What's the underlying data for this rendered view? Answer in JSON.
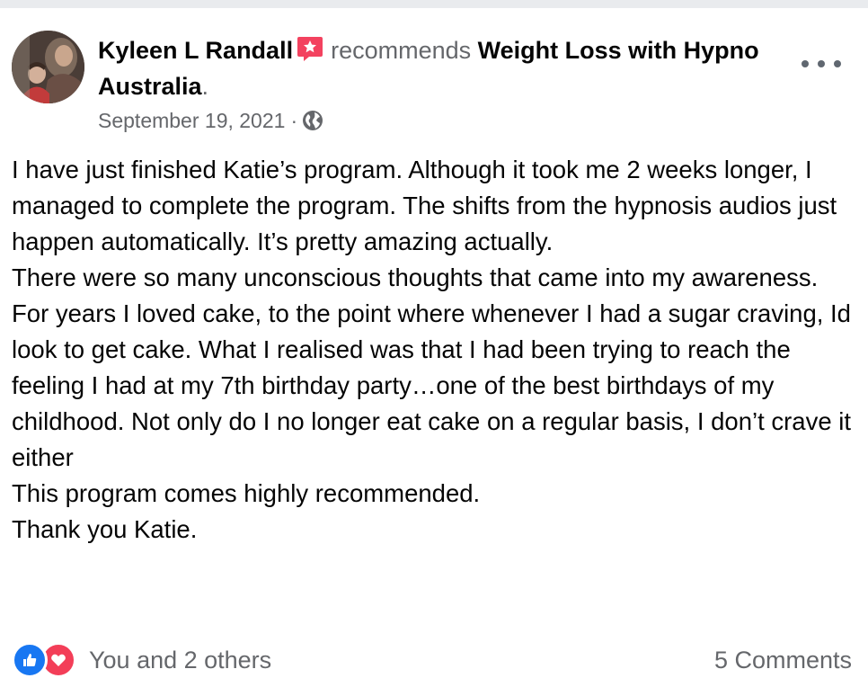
{
  "post": {
    "author": "Kyleen L Randall",
    "action": "recommends",
    "page_name": "Weight Loss with Hypno Australia",
    "trailing_period": ".",
    "date": "September 19, 2021",
    "separator": "·",
    "privacy_icon": "globe-icon",
    "menu_icon": "more-options-icon",
    "badge_icon": "recommendation-star-icon",
    "body": [
      "I have just finished Katie’s program. Although it took me 2 weeks longer, I managed to complete the program. The shifts from the hypnosis audios just happen automatically. It’s pretty amazing actually.",
      "There were so many unconscious thoughts that came into my awareness.",
      "For years I loved cake, to the point where whenever I had a sugar craving, Id look to get cake. What I realised was that I had been trying to reach the feeling I had at my 7th birthday party…one of the best birthdays of my childhood. Not only do I no longer eat cake on a regular basis, I don’t crave it either",
      "This program comes highly recommended.",
      "Thank you Katie."
    ]
  },
  "footer": {
    "reaction_icons": [
      "like-icon",
      "love-icon"
    ],
    "reactions_text": "You and 2 others",
    "comments_text": "5 Comments"
  },
  "colors": {
    "primary_text": "#050505",
    "secondary_text": "#65676b",
    "like_blue": "#1877f2",
    "love_red": "#f33e58",
    "badge_pink": "#f3425f"
  }
}
